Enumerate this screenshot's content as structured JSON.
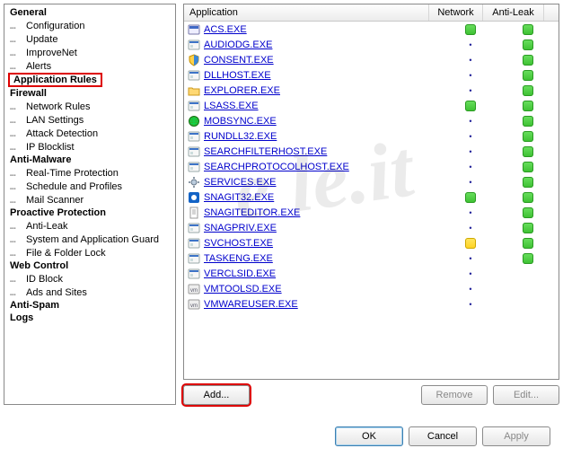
{
  "watermark": "e      le.it",
  "tree": [
    {
      "type": "cat",
      "label": "General"
    },
    {
      "type": "item",
      "label": "Configuration"
    },
    {
      "type": "item",
      "label": "Update"
    },
    {
      "type": "item",
      "label": "ImproveNet"
    },
    {
      "type": "item",
      "label": "Alerts"
    },
    {
      "type": "cat",
      "label": "Application Rules",
      "highlight": true
    },
    {
      "type": "cat",
      "label": "Firewall"
    },
    {
      "type": "item",
      "label": "Network Rules"
    },
    {
      "type": "item",
      "label": "LAN Settings"
    },
    {
      "type": "item",
      "label": "Attack Detection"
    },
    {
      "type": "item",
      "label": "IP Blocklist"
    },
    {
      "type": "cat",
      "label": "Anti-Malware"
    },
    {
      "type": "item",
      "label": "Real-Time Protection"
    },
    {
      "type": "item",
      "label": "Schedule and Profiles"
    },
    {
      "type": "item",
      "label": "Mail Scanner"
    },
    {
      "type": "cat",
      "label": "Proactive Protection"
    },
    {
      "type": "item",
      "label": "Anti-Leak"
    },
    {
      "type": "item",
      "label": "System and Application Guard"
    },
    {
      "type": "item",
      "label": "File & Folder Lock"
    },
    {
      "type": "cat",
      "label": "Web Control"
    },
    {
      "type": "item",
      "label": "ID Block"
    },
    {
      "type": "item",
      "label": "Ads and Sites"
    },
    {
      "type": "cat",
      "label": "Anti-Spam"
    },
    {
      "type": "cat",
      "label": "Logs"
    }
  ],
  "columns": {
    "app": "Application",
    "net": "Network",
    "leak": "Anti-Leak"
  },
  "rows": [
    {
      "name": "ACS.EXE",
      "icon": "console",
      "net": "green",
      "leak": "green"
    },
    {
      "name": "AUDIODG.EXE",
      "icon": "app",
      "net": "dot",
      "leak": "green"
    },
    {
      "name": "CONSENT.EXE",
      "icon": "shield",
      "net": "dot",
      "leak": "green"
    },
    {
      "name": "DLLHOST.EXE",
      "icon": "app",
      "net": "dot",
      "leak": "green"
    },
    {
      "name": "EXPLORER.EXE",
      "icon": "folder",
      "net": "dot",
      "leak": "green"
    },
    {
      "name": "LSASS.EXE",
      "icon": "app",
      "net": "green",
      "leak": "green"
    },
    {
      "name": "MOBSYNC.EXE",
      "icon": "globe",
      "net": "dot",
      "leak": "green"
    },
    {
      "name": "RUNDLL32.EXE",
      "icon": "app",
      "net": "dot",
      "leak": "green"
    },
    {
      "name": "SEARCHFILTERHOST.EXE",
      "icon": "app",
      "net": "dot",
      "leak": "green"
    },
    {
      "name": "SEARCHPROTOCOLHOST.EXE",
      "icon": "app",
      "net": "dot",
      "leak": "green"
    },
    {
      "name": "SERVICES.EXE",
      "icon": "gear",
      "net": "dot",
      "leak": "green"
    },
    {
      "name": "SNAGIT32.EXE",
      "icon": "snagit",
      "net": "green",
      "leak": "green"
    },
    {
      "name": "SNAGITEDITOR.EXE",
      "icon": "doc",
      "net": "dot",
      "leak": "green"
    },
    {
      "name": "SNAGPRIV.EXE",
      "icon": "app",
      "net": "dot",
      "leak": "green"
    },
    {
      "name": "SVCHOST.EXE",
      "icon": "app",
      "net": "yellow",
      "leak": "green"
    },
    {
      "name": "TASKENG.EXE",
      "icon": "app",
      "net": "dot",
      "leak": "green"
    },
    {
      "name": "VERCLSID.EXE",
      "icon": "app",
      "net": "dot",
      "leak": ""
    },
    {
      "name": "VMTOOLSD.EXE",
      "icon": "vm",
      "net": "dot",
      "leak": ""
    },
    {
      "name": "VMWAREUSER.EXE",
      "icon": "vm",
      "net": "dot",
      "leak": ""
    }
  ],
  "buttons": {
    "add": "Add...",
    "remove": "Remove",
    "edit": "Edit...",
    "ok": "OK",
    "cancel": "Cancel",
    "apply": "Apply"
  }
}
